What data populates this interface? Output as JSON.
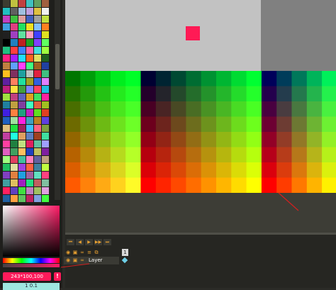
{
  "palette": {
    "colors": [
      "#3c3c30",
      "#c0c040",
      "#c04040",
      "#40c0c0",
      "#60a060",
      "#a06040",
      "#20c0c0",
      "#606060",
      "#a0c0e0",
      "#c0a0e0",
      "#e0c040",
      "#f0f0f0",
      "#c040c0",
      "#40c040",
      "#e0a0a0",
      "#4060c0",
      "#a0a0a0",
      "#c0e040",
      "#40a0e0",
      "#e04080",
      "#20e060",
      "#f0e020",
      "#80c0ff",
      "#ff8020",
      "#202020",
      "#a040c0",
      "#60e0a0",
      "#ffa0c0",
      "#4040ff",
      "#e0e020",
      "#000000",
      "#2080c0",
      "#c02020",
      "#20a020",
      "#8040ff",
      "#60ff60",
      "#20c080",
      "#ff4040",
      "#4080ff",
      "#ff60a0",
      "#40e0e0",
      "#a0ff40",
      "#ff2080",
      "#a020ff",
      "#20e0ff",
      "#ff6020",
      "#e0e060",
      "#206020",
      "#c08040",
      "#60a0ff",
      "#ff40ff",
      "#40ff80",
      "#a06020",
      "#2040a0",
      "#ffc020",
      "#803060",
      "#20a0a0",
      "#c0c0c0",
      "#e02040",
      "#40c080",
      "#6020a0",
      "#ff8060",
      "#20e0a0",
      "#a0a020",
      "#3060e0",
      "#e080ff",
      "#c02080",
      "#ffe040",
      "#40a040",
      "#8080ff",
      "#ff4060",
      "#20c0e0",
      "#a0e040",
      "#c04080",
      "#6060c0",
      "#e0a020",
      "#40e060",
      "#ff20a0",
      "#2080a0",
      "#c0a040",
      "#8040a0",
      "#40ffc0",
      "#e06040",
      "#a0c020",
      "#4020e0",
      "#ff8040",
      "#20a080",
      "#c020c0",
      "#60e020",
      "#e04020",
      "#2060c0",
      "#a0e0a0",
      "#ff20e0",
      "#40a0c0",
      "#c08020",
      "#6040e0",
      "#e0c080",
      "#20e040",
      "#a02060",
      "#40c0ff",
      "#ff6080",
      "#80a040",
      "#c040a0",
      "#20ffe0",
      "#e0a060",
      "#6080c0",
      "#a04020",
      "#40e0a0",
      "#ff40a0",
      "#208040",
      "#c0e080",
      "#e02060",
      "#60c0a0",
      "#a0a0ff",
      "#e060c0",
      "#40a060",
      "#ffc060",
      "#2040c0",
      "#c0c060",
      "#8020a0",
      "#a0ff80",
      "#e04060",
      "#40c0a0",
      "#ff80c0",
      "#6060a0",
      "#c0a080",
      "#20c060",
      "#e0e0a0",
      "#a040e0",
      "#ff6040",
      "#4080a0",
      "#c0ff40",
      "#8040c0",
      "#e08040",
      "#20a0e0",
      "#a060a0",
      "#60e0c0",
      "#ff4080",
      "#40a0a0",
      "#e0c060",
      "#a020c0",
      "#20e080",
      "#c06060",
      "#80c0a0",
      "#ff2060",
      "#6040c0",
      "#40e040",
      "#c080c0",
      "#a0c060",
      "#e0a0e0",
      "#2060a0",
      "#ffa040",
      "#60c060",
      "#c02060",
      "#80a0e0",
      "#40ff40"
    ]
  },
  "color_picker": {
    "rgb_value": "243*100,100",
    "warning_label": "!",
    "tab_label": "1 0.1"
  },
  "canvas": {
    "light_bg": "#c2c2c2",
    "dark_bg": "#808080",
    "square_color": "#ff1a55"
  },
  "timeline": {
    "buttons": [
      "⏮",
      "◀",
      "▶",
      "▶▶",
      "⏭"
    ],
    "layer_name": "Layer",
    "frame_number": "1"
  }
}
